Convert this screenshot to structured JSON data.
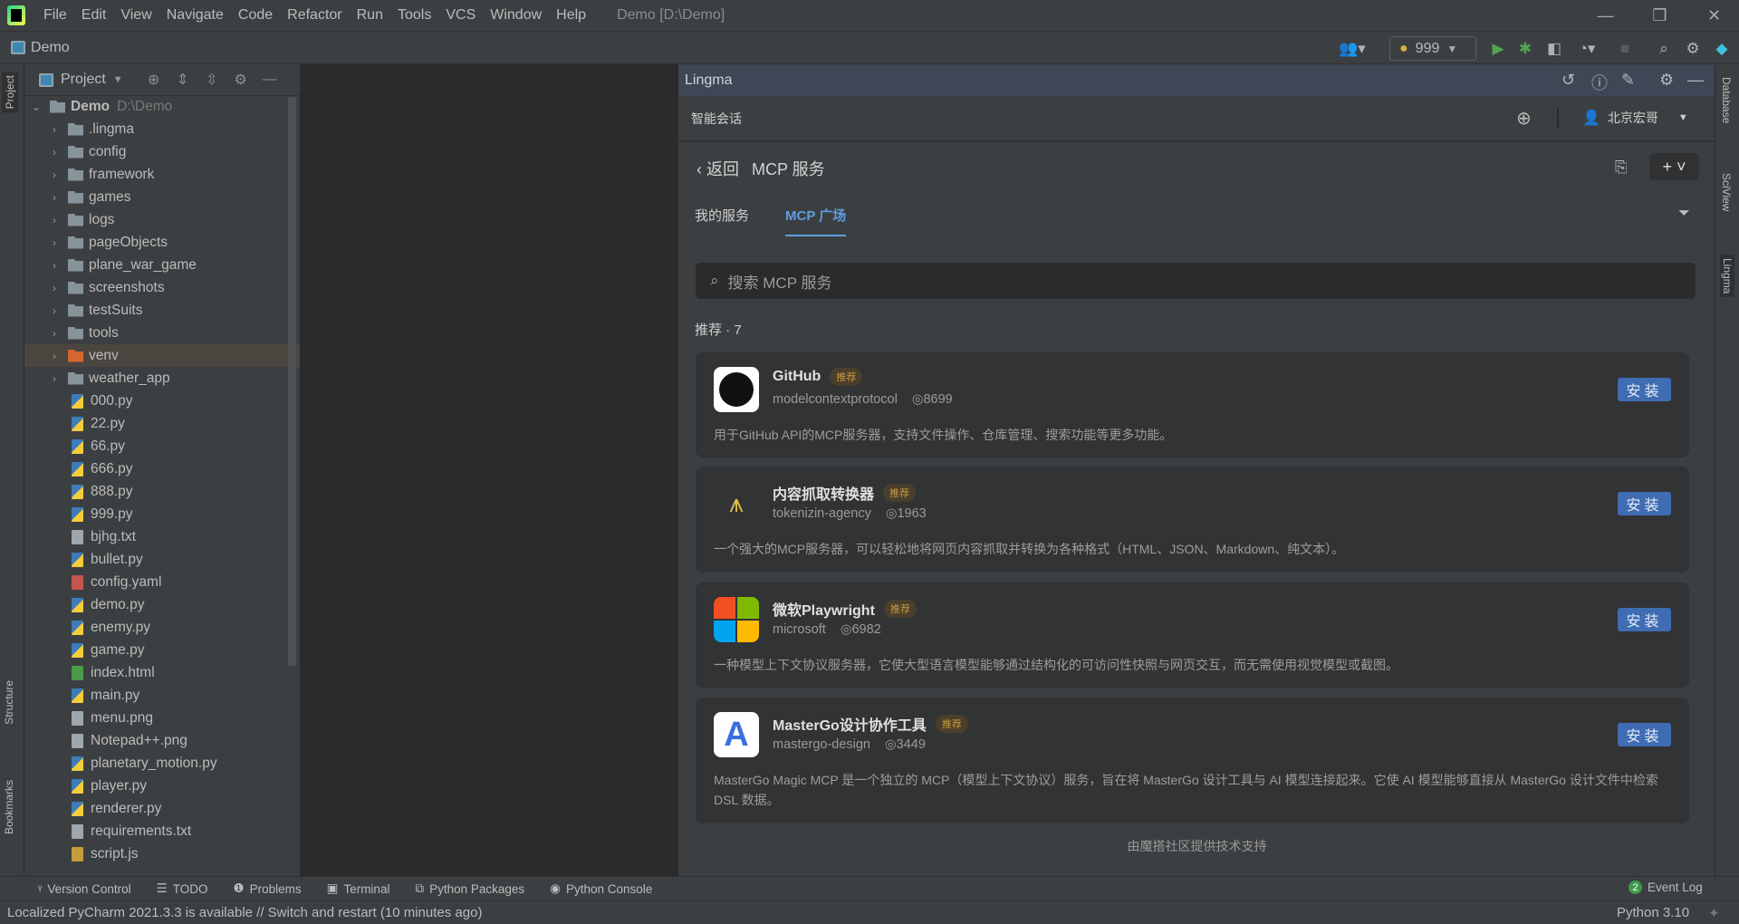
{
  "titlebar": {
    "menus": [
      "File",
      "Edit",
      "View",
      "Navigate",
      "Code",
      "Refactor",
      "Run",
      "Tools",
      "VCS",
      "Window",
      "Help"
    ],
    "title": "Demo [D:\\Demo]"
  },
  "navbar": {
    "project": "Demo",
    "run_config": "999"
  },
  "stripes": {
    "left": [
      "Project",
      "Structure",
      "Bookmarks"
    ],
    "right": [
      "Database",
      "SciView",
      "Lingma"
    ]
  },
  "project_panel": {
    "title": "Project",
    "tree": [
      {
        "name": "Demo",
        "path": "D:\\Demo",
        "type": "root"
      },
      {
        "name": ".lingma",
        "type": "folder"
      },
      {
        "name": "config",
        "type": "folder"
      },
      {
        "name": "framework",
        "type": "folder"
      },
      {
        "name": "games",
        "type": "folder"
      },
      {
        "name": "logs",
        "type": "folder"
      },
      {
        "name": "pageObjects",
        "type": "folder"
      },
      {
        "name": "plane_war_game",
        "type": "folder"
      },
      {
        "name": "screenshots",
        "type": "folder"
      },
      {
        "name": "testSuits",
        "type": "folder"
      },
      {
        "name": "tools",
        "type": "folder"
      },
      {
        "name": "venv",
        "type": "venv"
      },
      {
        "name": "weather_app",
        "type": "folder"
      },
      {
        "name": "000.py",
        "type": "py"
      },
      {
        "name": "22.py",
        "type": "py"
      },
      {
        "name": "66.py",
        "type": "py"
      },
      {
        "name": "666.py",
        "type": "py"
      },
      {
        "name": "888.py",
        "type": "py"
      },
      {
        "name": "999.py",
        "type": "py"
      },
      {
        "name": "bjhg.txt",
        "type": "txt"
      },
      {
        "name": "bullet.py",
        "type": "py"
      },
      {
        "name": "config.yaml",
        "type": "yaml"
      },
      {
        "name": "demo.py",
        "type": "py"
      },
      {
        "name": "enemy.py",
        "type": "py"
      },
      {
        "name": "game.py",
        "type": "py"
      },
      {
        "name": "index.html",
        "type": "html"
      },
      {
        "name": "main.py",
        "type": "py"
      },
      {
        "name": "menu.png",
        "type": "txt"
      },
      {
        "name": "Notepad++.png",
        "type": "txt"
      },
      {
        "name": "planetary_motion.py",
        "type": "py"
      },
      {
        "name": "player.py",
        "type": "py"
      },
      {
        "name": "renderer.py",
        "type": "py"
      },
      {
        "name": "requirements.txt",
        "type": "txt"
      },
      {
        "name": "script.js",
        "type": "js"
      }
    ]
  },
  "lingma": {
    "title": "Lingma",
    "chat_label": "智能会话",
    "user": "北京宏哥",
    "back": "返回",
    "page_title": "MCP 服务",
    "tabs": [
      "我的服务",
      "MCP 广场"
    ],
    "search_placeholder": "搜索 MCP 服务",
    "recommend": "推荐 · 7",
    "badge": "推荐",
    "install": "安装",
    "cards": [
      {
        "name": "GitHub",
        "author": "modelcontextprotocol",
        "views": "8699",
        "desc": "用于GitHub API的MCP服务器，支持文件操作、仓库管理、搜索功能等更多功能。"
      },
      {
        "name": "内容抓取转换器",
        "author": "tokenizin-agency",
        "views": "1963",
        "desc": "一个强大的MCP服务器，可以轻松地将网页内容抓取并转换为各种格式（HTML、JSON、Markdown、纯文本）。"
      },
      {
        "name": "微软Playwright",
        "author": "microsoft",
        "views": "6982",
        "desc": "一种模型上下文协议服务器，它使大型语言模型能够通过结构化的可访问性快照与网页交互，而无需使用视觉模型或截图。"
      },
      {
        "name": "MasterGo设计协作工具",
        "author": "mastergo-design",
        "views": "3449",
        "desc": "MasterGo Magic MCP 是一个独立的 MCP（模型上下文协议）服务，旨在将 MasterGo 设计工具与 AI 模型连接起来。它使 AI 模型能够直接从 MasterGo 设计文件中检索 DSL 数据。"
      }
    ],
    "footer": "由魔搭社区提供技术支持"
  },
  "bottom_tools": [
    "Version Control",
    "TODO",
    "Problems",
    "Terminal",
    "Python Packages",
    "Python Console"
  ],
  "event_log": {
    "count": "2",
    "label": "Event Log"
  },
  "status": {
    "message": "Localized PyCharm 2021.3.3 is available // Switch and restart (10 minutes ago)",
    "interpreter": "Python 3.10"
  }
}
